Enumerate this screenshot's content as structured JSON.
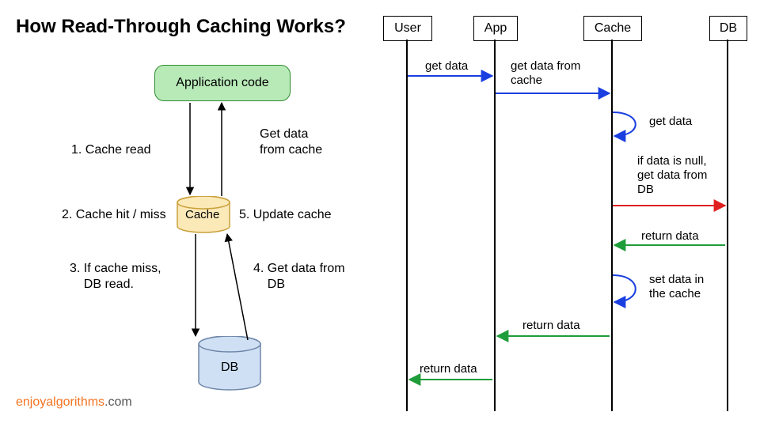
{
  "title": "How Read-Through Caching Works?",
  "left_flow": {
    "app_box": "Application code",
    "cache_label": "Cache",
    "db_label": "DB",
    "steps": {
      "s1": "1. Cache read",
      "s2": "2. Cache hit / miss",
      "s3": "3. If cache miss,\n    DB read.",
      "s4": "4. Get data from\n    DB",
      "s5": "5. Update cache",
      "s_get": "Get data\nfrom cache"
    }
  },
  "sequence": {
    "actors": {
      "user": "User",
      "app": "App",
      "cache": "Cache",
      "db": "DB"
    },
    "messages": {
      "m1": "get data",
      "m2": "get data from\ncache",
      "m3": "get data",
      "m4": "if data is null,\nget data from\nDB",
      "m5": "return data",
      "m6": "set data in\nthe cache",
      "m7": "return data",
      "m8": "return data"
    }
  },
  "brand": {
    "primary": "enjoyalgorithms",
    "suffix": ".com"
  },
  "colors": {
    "blue": "#1a3fe0",
    "green": "#1f9d3a",
    "red": "#e02020",
    "black": "#000000"
  },
  "chart_data": {
    "type": "diagram",
    "left_flow_steps": [
      {
        "n": 1,
        "from": "Application code",
        "to": "Cache",
        "text": "Cache read"
      },
      {
        "n": 2,
        "at": "Cache",
        "text": "Cache hit / miss"
      },
      {
        "n": 3,
        "from": "Cache",
        "to": "DB",
        "text": "If cache miss, DB read."
      },
      {
        "n": 4,
        "from": "DB",
        "to": "Cache",
        "text": "Get data from DB"
      },
      {
        "n": 5,
        "at": "Cache",
        "text": "Update cache"
      },
      {
        "n": null,
        "from": "Cache",
        "to": "Application code",
        "text": "Get data from cache"
      }
    ],
    "sequence_messages": [
      {
        "from": "User",
        "to": "App",
        "label": "get data",
        "kind": "request"
      },
      {
        "from": "App",
        "to": "Cache",
        "label": "get data from cache",
        "kind": "request"
      },
      {
        "from": "Cache",
        "to": "Cache",
        "label": "get data",
        "kind": "self"
      },
      {
        "from": "Cache",
        "to": "DB",
        "label": "if data is null, get data from DB",
        "kind": "miss"
      },
      {
        "from": "DB",
        "to": "Cache",
        "label": "return data",
        "kind": "response"
      },
      {
        "from": "Cache",
        "to": "Cache",
        "label": "set data in the cache",
        "kind": "self"
      },
      {
        "from": "Cache",
        "to": "App",
        "label": "return data",
        "kind": "response"
      },
      {
        "from": "App",
        "to": "User",
        "label": "return data",
        "kind": "response"
      }
    ]
  }
}
